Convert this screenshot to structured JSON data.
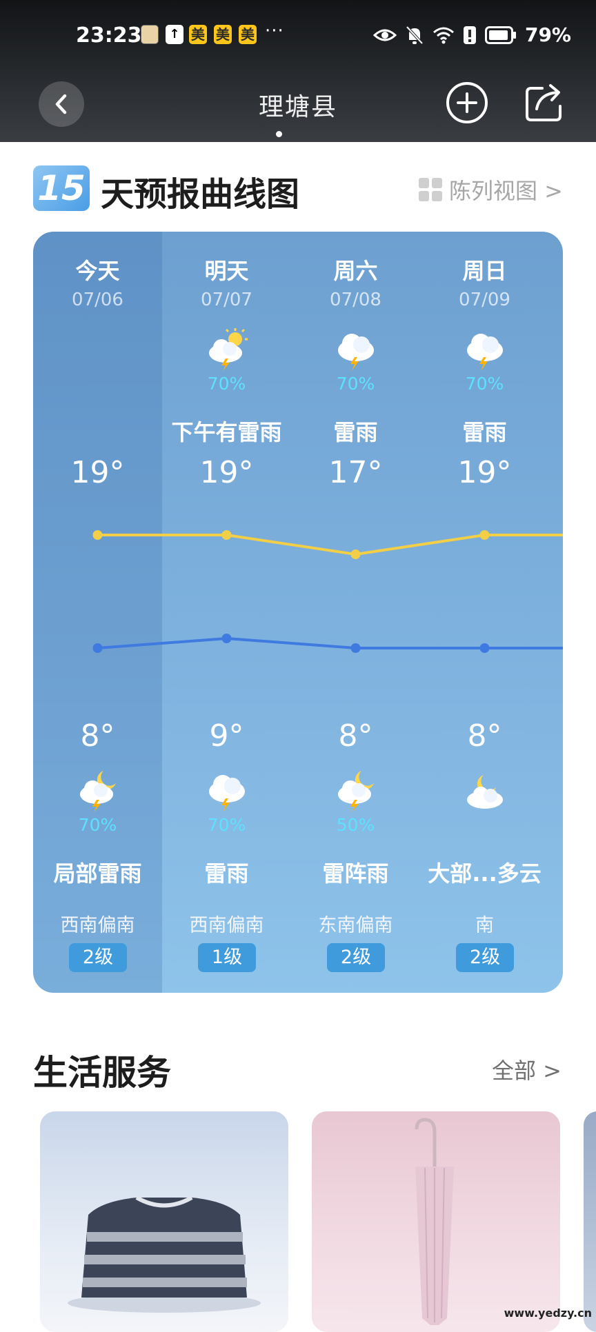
{
  "status_bar": {
    "time": "23:23",
    "notif_icons": [
      "app-icon",
      "upload-icon"
    ],
    "mei_labels": [
      "美",
      "美",
      "美"
    ],
    "more": "···",
    "battery": "79%"
  },
  "nav": {
    "city": "理塘县"
  },
  "forecast": {
    "badge": "15",
    "title": "天预报曲线图",
    "grid_view_label": "陈列视图 >",
    "days": [
      {
        "day": "今天",
        "date": "07/06",
        "day_pct": "",
        "day_cond": "",
        "high": "19°",
        "low": "8°",
        "night_pct": "70%",
        "night_cond": "局部雷雨",
        "wind": "西南偏南",
        "level": "2级",
        "day_icon": "none",
        "night_icon": "moon-thunder-icon"
      },
      {
        "day": "明天",
        "date": "07/07",
        "day_pct": "70%",
        "day_cond": "下午有雷雨",
        "high": "19°",
        "low": "9°",
        "night_pct": "70%",
        "night_cond": "雷雨",
        "wind": "西南偏南",
        "level": "1级",
        "day_icon": "sun-thunder-icon",
        "night_icon": "thunderstorm-icon"
      },
      {
        "day": "周六",
        "date": "07/08",
        "day_pct": "70%",
        "day_cond": "雷雨",
        "high": "17°",
        "low": "8°",
        "night_pct": "50%",
        "night_cond": "雷阵雨",
        "wind": "东南偏南",
        "level": "2级",
        "day_icon": "thunderstorm-icon",
        "night_icon": "moon-thunder-icon"
      },
      {
        "day": "周日",
        "date": "07/09",
        "day_pct": "70%",
        "day_cond": "雷雨",
        "high": "19°",
        "low": "8°",
        "night_pct": "",
        "night_cond": "大部...多云",
        "wind": "南",
        "level": "2级",
        "day_icon": "thunderstorm-icon",
        "night_icon": "moon-cloud-icon"
      }
    ],
    "colors": {
      "high_line": "#f2cf47",
      "low_line": "#3f7ae0"
    }
  },
  "chart_data": {
    "type": "line",
    "categories": [
      "今天",
      "明天",
      "周六",
      "周日"
    ],
    "series": [
      {
        "values": [
          19,
          19,
          17,
          19
        ]
      },
      {
        "values": [
          8,
          9,
          8,
          8
        ]
      }
    ]
  },
  "life_services": {
    "title": "生活服务",
    "all_label": "全部 >"
  },
  "watermark": "www.yedzy.cn"
}
